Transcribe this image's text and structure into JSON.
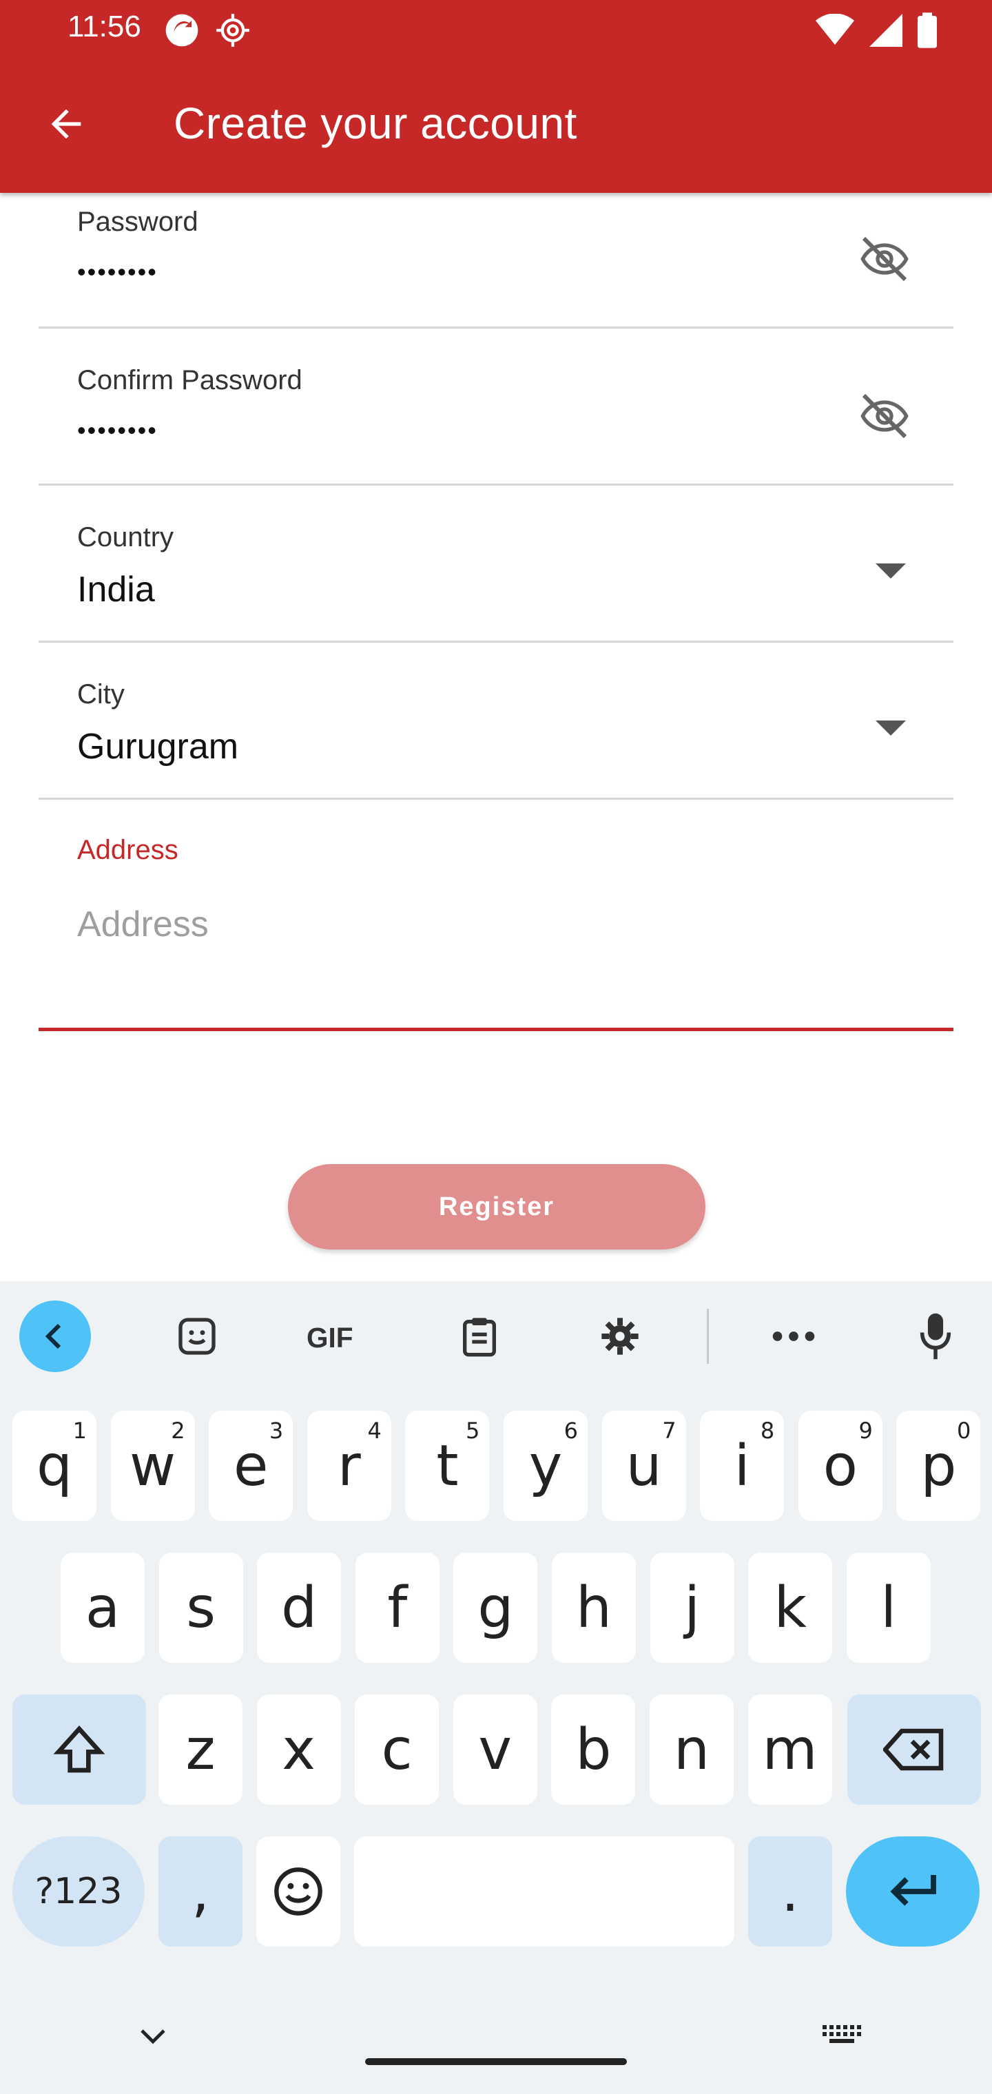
{
  "status": {
    "time": "11:56"
  },
  "appbar": {
    "title": "Create your account",
    "back_icon": "arrow-back-icon"
  },
  "form": {
    "password": {
      "label": "Password",
      "value": "••••••••",
      "toggle_icon": "eye-off-icon"
    },
    "confirm_password": {
      "label": "Confirm Password",
      "value": "••••••••",
      "toggle_icon": "eye-off-icon"
    },
    "country": {
      "label": "Country",
      "value": "India"
    },
    "city": {
      "label": "City",
      "value": "Gurugram"
    },
    "address": {
      "label": "Address",
      "placeholder": "Address"
    },
    "register_label": "Register"
  },
  "colors": {
    "primary": "#C62828",
    "register_bg": "#E08E8E",
    "accent_key": "#4FC3F7"
  },
  "keyboard": {
    "row1": [
      {
        "k": "q",
        "s": "1"
      },
      {
        "k": "w",
        "s": "2"
      },
      {
        "k": "e",
        "s": "3"
      },
      {
        "k": "r",
        "s": "4"
      },
      {
        "k": "t",
        "s": "5"
      },
      {
        "k": "y",
        "s": "6"
      },
      {
        "k": "u",
        "s": "7"
      },
      {
        "k": "i",
        "s": "8"
      },
      {
        "k": "o",
        "s": "9"
      },
      {
        "k": "p",
        "s": "0"
      }
    ],
    "row2": [
      "a",
      "s",
      "d",
      "f",
      "g",
      "h",
      "j",
      "k",
      "l"
    ],
    "row3": [
      "z",
      "x",
      "c",
      "v",
      "b",
      "n",
      "m"
    ],
    "sym_label": "?123",
    "comma": ",",
    "period": "."
  }
}
